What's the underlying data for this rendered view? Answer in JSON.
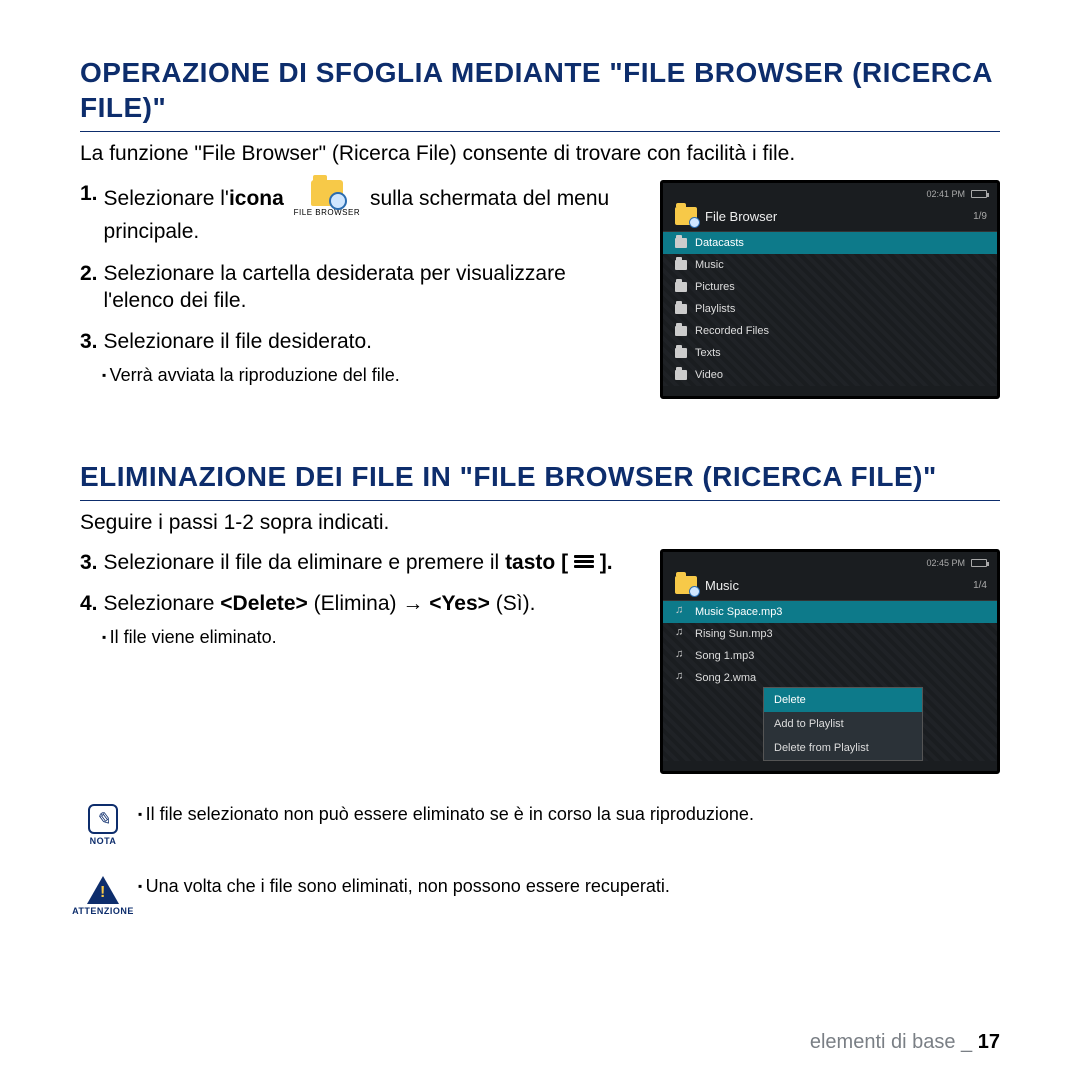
{
  "section1": {
    "title": "OPERAZIONE DI SFOGLIA MEDIANTE \"FILE BROWSER (RICERCA FILE)\"",
    "intro": "La funzione \"File Browser\" (Ricerca File) consente di trovare con facilità i file.",
    "step1_a": "Selezionare l'",
    "step1_b": "icona",
    "step1_c": "sulla schermata del menu principale.",
    "icon_label": "FILE BROWSER",
    "step2": "Selezionare la cartella desiderata per visualizzare l'elenco dei file.",
    "step3": "Selezionare il file desiderato.",
    "sub3": "Verrà avviata la riproduzione del file."
  },
  "screenshot1": {
    "time": "02:41 PM",
    "title": "File Browser",
    "count": "1/9",
    "items": [
      "Datacasts",
      "Music",
      "Pictures",
      "Playlists",
      "Recorded Files",
      "Texts",
      "Video"
    ]
  },
  "section2": {
    "title": "ELIMINAZIONE DEI FILE IN \"FILE BROWSER (RICERCA FILE)\"",
    "followup": "Seguire i passi 1-2 sopra indicati.",
    "step3_a": "Selezionare il file da eliminare e premere il",
    "step3_b": "tasto [",
    "step3_c": "].",
    "step4_a": "Selezionare ",
    "step4_b": "<Delete>",
    "step4_c": " (Elimina) → ",
    "step4_d": "<Yes>",
    "step4_e": " (Sì).",
    "sub4": "Il file viene eliminato."
  },
  "screenshot2": {
    "time": "02:45 PM",
    "title": "Music",
    "count": "1/4",
    "items": [
      "Music Space.mp3",
      "Rising Sun.mp3",
      "Song 1.mp3",
      "Song 2.wma"
    ],
    "menu": [
      "Delete",
      "Add to Playlist",
      "Delete from Playlist"
    ]
  },
  "notes": {
    "nota_label": "NOTA",
    "nota_text": "Il file selezionato non può essere eliminato se è in corso la sua riproduzione.",
    "att_label": "ATTENZIONE",
    "att_text": "Una volta che i file sono eliminati, non possono essere recuperati."
  },
  "footer": {
    "text": "elementi di base _ ",
    "page": "17"
  }
}
